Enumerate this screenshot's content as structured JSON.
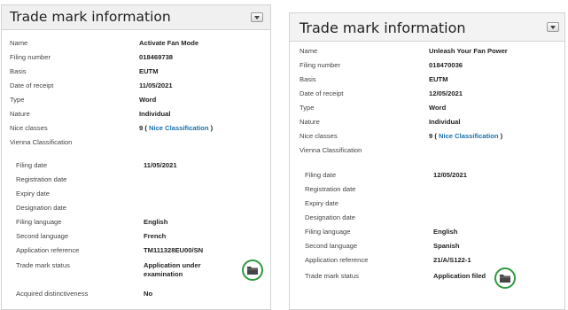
{
  "left": {
    "title": "Trade mark information",
    "rows": [
      {
        "label": "Name",
        "value": "Activate Fan Mode"
      },
      {
        "label": "Filing number",
        "value": "018469738"
      },
      {
        "label": "Basis",
        "value": "EUTM"
      },
      {
        "label": "Date of receipt",
        "value": "11/05/2021"
      },
      {
        "label": "Type",
        "value": "Word"
      },
      {
        "label": "Nature",
        "value": "Individual"
      },
      {
        "label": "Nice classes",
        "value_prefix": "9 ( ",
        "link": "Nice Classification",
        "value_suffix": " )"
      },
      {
        "label": "Vienna Classification",
        "value": ""
      },
      {
        "label": "Filing date",
        "value": "11/05/2021"
      },
      {
        "label": "Registration date",
        "value": ""
      },
      {
        "label": "Expiry date",
        "value": ""
      },
      {
        "label": "Designation date",
        "value": ""
      },
      {
        "label": "Filing language",
        "value": "English"
      },
      {
        "label": "Second language",
        "value": "French"
      },
      {
        "label": "Application reference",
        "value": "TM111328EU00/SN"
      },
      {
        "label": "Trade mark status",
        "value_line1": "Application under",
        "value_line2": "examination"
      },
      {
        "label": "Acquired distinctiveness",
        "value": "No"
      }
    ]
  },
  "right": {
    "title": "Trade mark information",
    "rows": [
      {
        "label": "Name",
        "value": "Unleash Your Fan Power"
      },
      {
        "label": "Filing number",
        "value": "018470036"
      },
      {
        "label": "Basis",
        "value": "EUTM"
      },
      {
        "label": "Date of receipt",
        "value": "12/05/2021"
      },
      {
        "label": "Type",
        "value": "Word"
      },
      {
        "label": "Nature",
        "value": "Individual"
      },
      {
        "label": "Nice classes",
        "value_prefix": "9 ( ",
        "link": "Nice Classification",
        "value_suffix": " )"
      },
      {
        "label": "Vienna Classification",
        "value": ""
      },
      {
        "label": "Filing date",
        "value": "12/05/2021"
      },
      {
        "label": "Registration date",
        "value": ""
      },
      {
        "label": "Expiry date",
        "value": ""
      },
      {
        "label": "Designation date",
        "value": ""
      },
      {
        "label": "Filing language",
        "value": "English"
      },
      {
        "label": "Second language",
        "value": "Spanish"
      },
      {
        "label": "Application reference",
        "value": "21/A/S122-1"
      },
      {
        "label": "Trade mark status",
        "value": "Application filed"
      }
    ]
  },
  "icons": {
    "collapse": "collapse-toggle-icon",
    "status": "folder-icon",
    "status_ring_color": "#2e9a3e"
  }
}
